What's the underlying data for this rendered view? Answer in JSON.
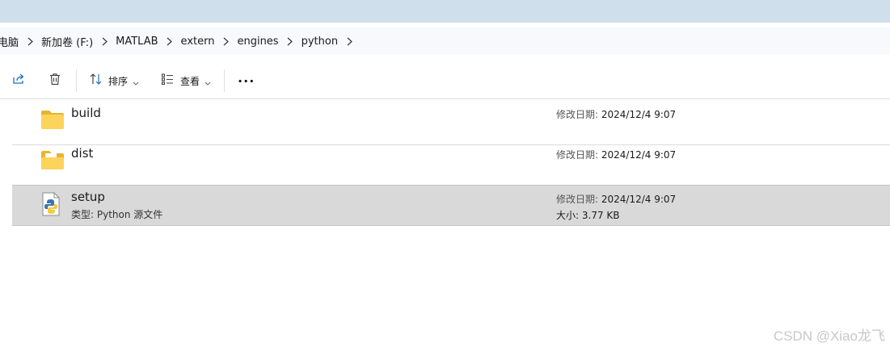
{
  "breadcrumb": [
    "电脑",
    "新加卷 (F:)",
    "MATLAB",
    "extern",
    "engines",
    "python"
  ],
  "toolbar": {
    "share_icon": "share-icon",
    "delete_icon": "trash-icon",
    "sort_label": "排序",
    "view_label": "查看",
    "more_label": "···"
  },
  "files": [
    {
      "name": "build",
      "icon": "folder-icon",
      "modified_label": "修改日期:",
      "modified": "2024/12/4 9:07"
    },
    {
      "name": "dist",
      "icon": "folder-icon",
      "modified_label": "修改日期:",
      "modified": "2024/12/4 9:07"
    },
    {
      "name": "setup",
      "icon": "python-file-icon",
      "type_label": "类型:",
      "type": "Python 源文件",
      "modified_label": "修改日期:",
      "modified": "2024/12/4 9:07",
      "size_label": "大小:",
      "size": "3.77 KB",
      "selected": true
    }
  ],
  "watermark": "CSDN @Xiao龙飞",
  "colors": {
    "accent": "#1f6fbf",
    "selected_bg": "#d9d9d9",
    "titlebar": "#cfdfeb"
  }
}
